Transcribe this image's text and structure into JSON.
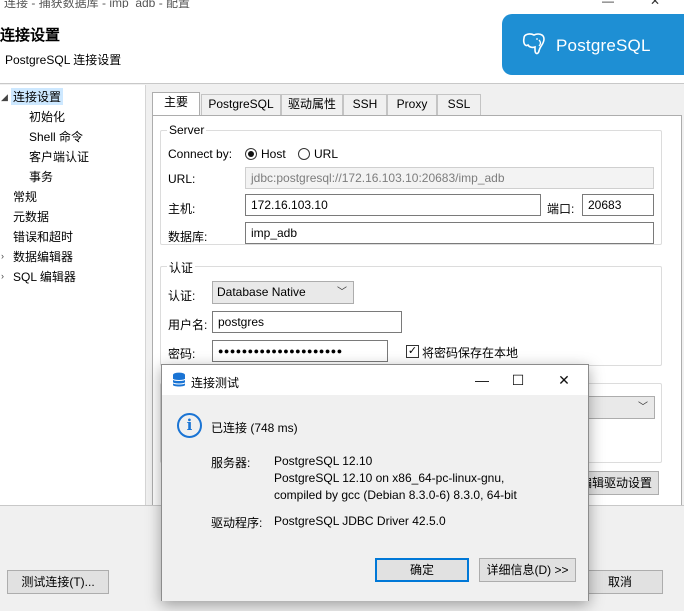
{
  "window": {
    "title": "连接 - 捕获数据库 - imp_adb - 配置"
  },
  "header": {
    "title": "连接设置",
    "subtitle": "PostgreSQL 连接设置",
    "logo_text": "PostgreSQL",
    "logo_color": "#1e8fd4"
  },
  "nav": {
    "items": [
      {
        "label": "连接设置",
        "selected": true
      },
      {
        "label": "初始化"
      },
      {
        "label": "Shell 命令"
      },
      {
        "label": "客户端认证"
      },
      {
        "label": "事务"
      },
      {
        "label": "常规"
      },
      {
        "label": "元数据"
      },
      {
        "label": "错误和超时"
      },
      {
        "label": "数据编辑器"
      },
      {
        "label": "SQL 编辑器"
      }
    ]
  },
  "tabs": [
    {
      "label": "主要",
      "active": true
    },
    {
      "label": "PostgreSQL"
    },
    {
      "label": "驱动属性"
    },
    {
      "label": "SSH"
    },
    {
      "label": "Proxy"
    },
    {
      "label": "SSL"
    }
  ],
  "server": {
    "group_title": "Server",
    "connect_by_label": "Connect by:",
    "host_option": "Host",
    "url_option": "URL",
    "url_label": "URL:",
    "url_value": "jdbc:postgresql://172.16.103.10:20683/imp_adb",
    "host_label": "主机:",
    "host_value": "172.16.103.10",
    "port_label": "端口:",
    "port_value": "20683",
    "db_label": "数据库:",
    "db_value": "imp_adb"
  },
  "auth": {
    "group_title": "认证",
    "auth_label": "认证:",
    "auth_value": "Database Native",
    "user_label": "用户名:",
    "user_value": "postgres",
    "password_label": "密码:",
    "password_value": "●●●●●●●●●●●●●●●●●●●●●",
    "save_password_label": "将密码保存在本地",
    "save_password_checked": "✓"
  },
  "partial": {
    "driver_settings_button": "编辑驱动设置"
  },
  "bottom": {
    "test_connection_button": "测试连接(T)...",
    "cancel_button": "取消"
  },
  "dialog": {
    "title": "连接测试",
    "status": "已连接 (748 ms)",
    "server_label": "服务器:",
    "server_line1": "PostgreSQL 12.10",
    "server_line2": "PostgreSQL 12.10 on x86_64-pc-linux-gnu,",
    "server_line3": "compiled by gcc (Debian 8.3.0-6) 8.3.0, 64-bit",
    "driver_label": "驱动程序:",
    "driver_value": "PostgreSQL JDBC Driver 42.5.0",
    "ok_button": "确定",
    "details_button": "详细信息(D) >>"
  }
}
